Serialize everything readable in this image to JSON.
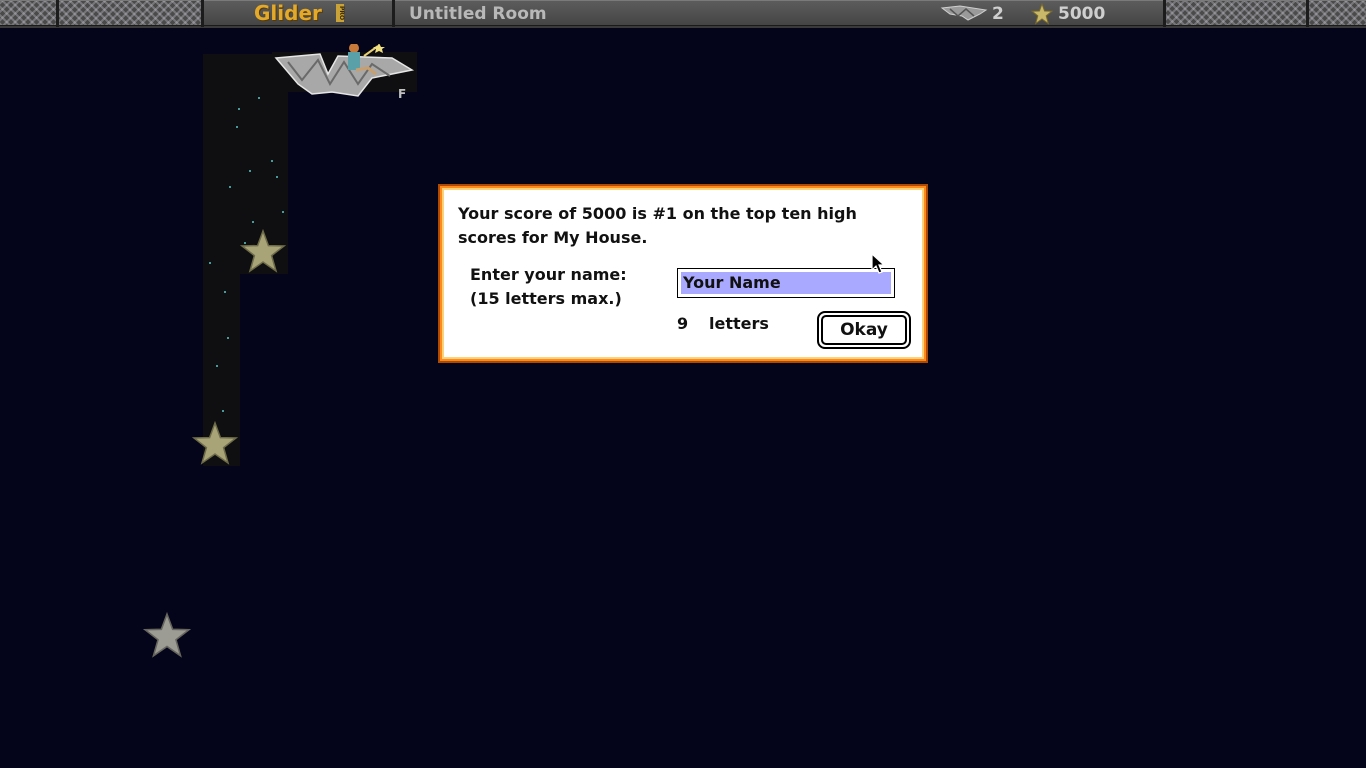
{
  "status_bar": {
    "logo_text": "Glider",
    "logo_badge": "PRO",
    "room_name": "Untitled Room",
    "lives_icon": "glider-icon",
    "lives": "2",
    "score_icon": "star-icon",
    "score": "5000"
  },
  "dialog": {
    "message_line1": "Your score of 5000 is #1 on the top ten high",
    "message_line2": "scores for My House.",
    "prompt_line1": "Enter your name:",
    "prompt_line2": "(15 letters max.)",
    "name_value": "Your Name",
    "letter_count": "9",
    "letter_count_label": "letters",
    "okay_label": "Okay"
  },
  "colors": {
    "background": "#04041a",
    "dialog_frame": "#ff8a1c",
    "selection": "#a9a9ff",
    "logo": "#e3a92a",
    "star": "#b9b07a"
  }
}
